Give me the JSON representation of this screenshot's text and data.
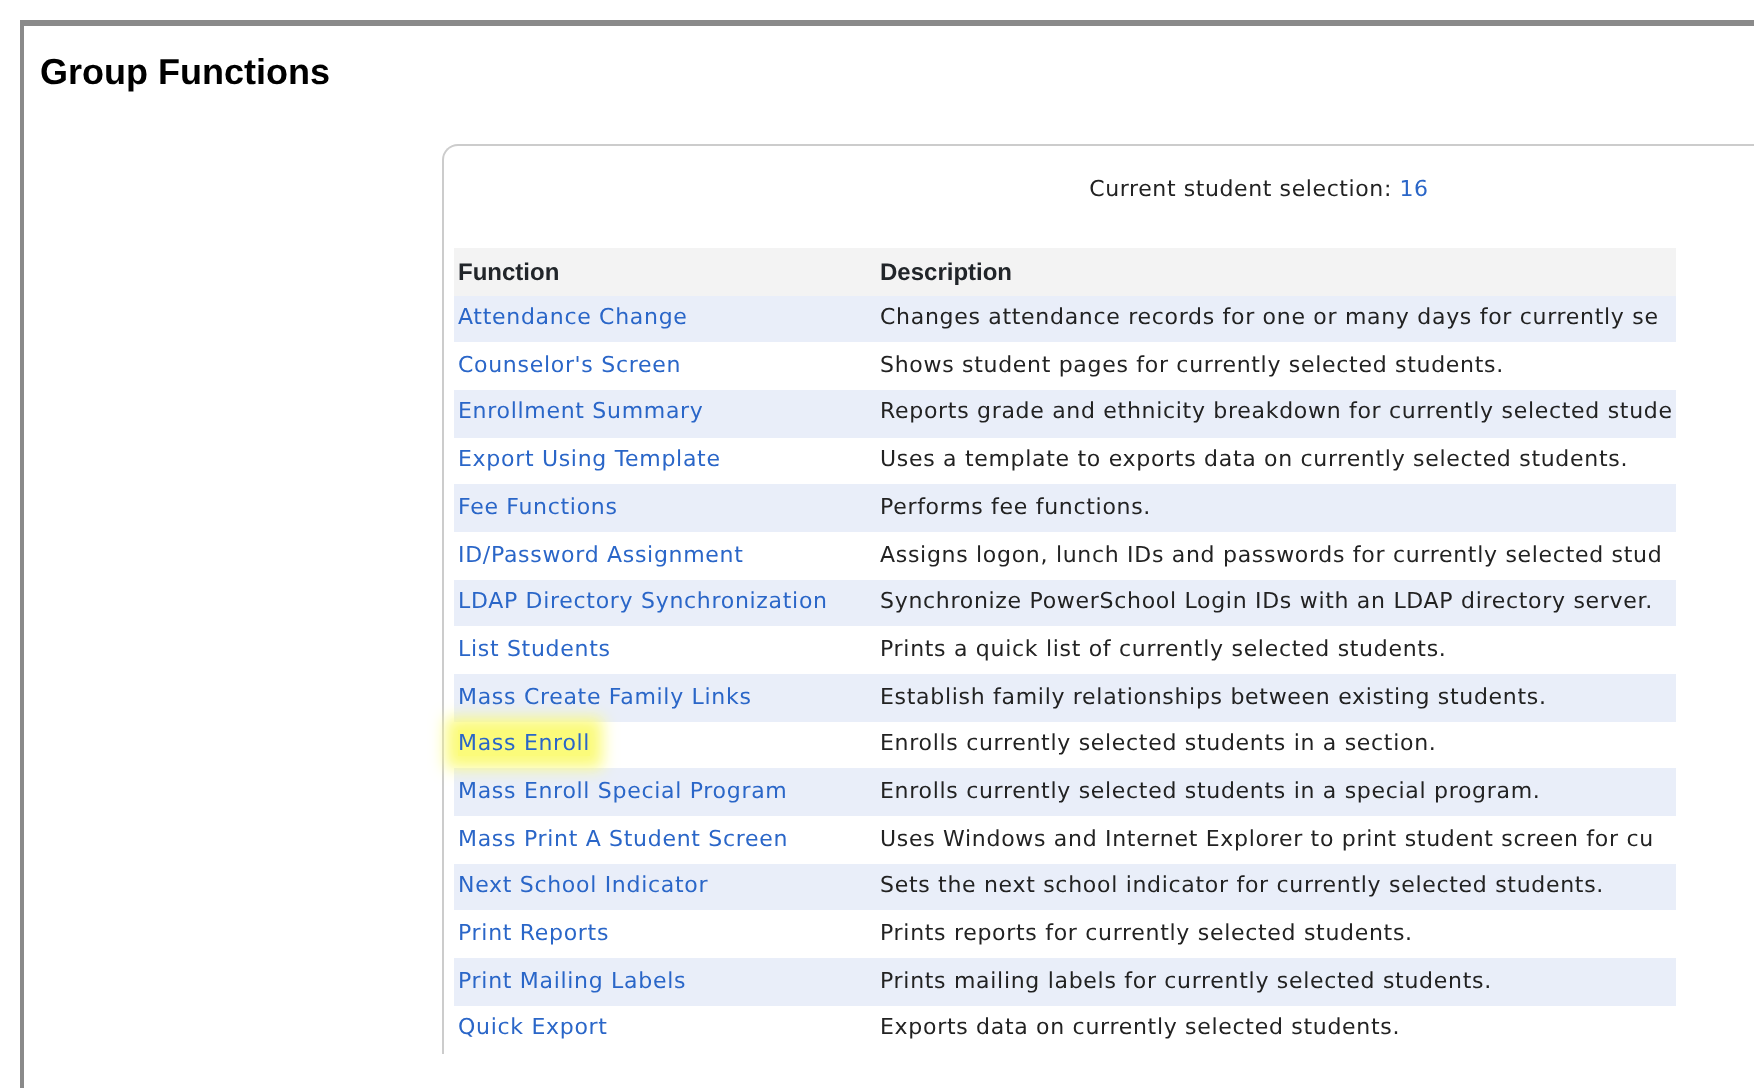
{
  "page_title": "Group Functions",
  "selection": {
    "label": "Current student selection:",
    "count": "16"
  },
  "table": {
    "columns": [
      "Function",
      "Description"
    ],
    "rows": [
      {
        "function": "Attendance Change",
        "description": "Changes attendance records for one or many days for currently se",
        "highlighted": false
      },
      {
        "function": "Counselor's Screen",
        "description": "Shows student pages for currently selected students.",
        "highlighted": false
      },
      {
        "function": "Enrollment Summary",
        "description": "Reports grade and ethnicity breakdown for currently selected stude",
        "highlighted": false
      },
      {
        "function": "Export Using Template",
        "description": "Uses a template to exports data on currently selected students.",
        "highlighted": false
      },
      {
        "function": "Fee Functions",
        "description": "Performs fee functions.",
        "highlighted": false
      },
      {
        "function": "ID/Password Assignment",
        "description": "Assigns logon, lunch IDs and passwords for currently selected stud",
        "highlighted": false
      },
      {
        "function": "LDAP Directory Synchronization",
        "description": "Synchronize PowerSchool Login IDs with an LDAP directory server.",
        "highlighted": false
      },
      {
        "function": "List Students",
        "description": "Prints a quick list of currently selected students.",
        "highlighted": false
      },
      {
        "function": "Mass Create Family Links",
        "description": "Establish family relationships between existing students.",
        "highlighted": false
      },
      {
        "function": "Mass Enroll",
        "description": "Enrolls currently selected students in a section.",
        "highlighted": true
      },
      {
        "function": "Mass Enroll Special Program",
        "description": "Enrolls currently selected students in a special program.",
        "highlighted": false
      },
      {
        "function": "Mass Print A Student Screen",
        "description": "Uses Windows and Internet Explorer to print student screen for cu",
        "highlighted": false
      },
      {
        "function": "Next School Indicator",
        "description": "Sets the next school indicator for currently selected students.",
        "highlighted": false
      },
      {
        "function": "Print Reports",
        "description": "Prints reports for currently selected students.",
        "highlighted": false
      },
      {
        "function": "Print Mailing Labels",
        "description": "Prints mailing labels for currently selected students.",
        "highlighted": false
      },
      {
        "function": "Quick Export",
        "description": "Exports data on currently selected students.",
        "highlighted": false
      }
    ]
  }
}
